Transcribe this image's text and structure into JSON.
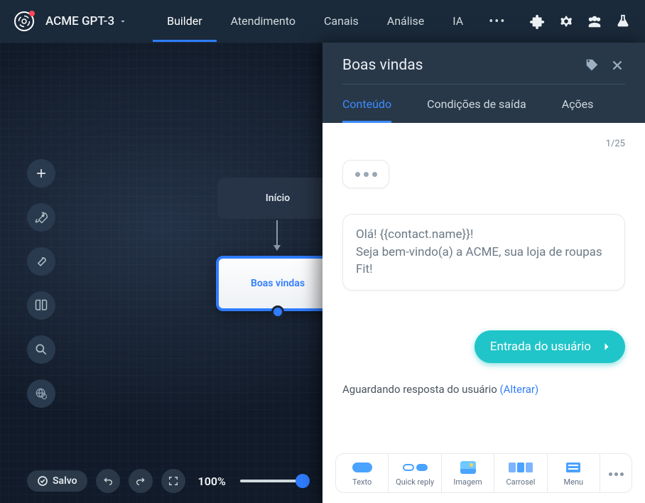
{
  "app_title": "ACME GPT-3",
  "nav": {
    "tabs": [
      "Builder",
      "Atendimento",
      "Canais",
      "Análise",
      "IA"
    ],
    "active": 0
  },
  "canvas": {
    "nodes": {
      "start": "Início",
      "welcome": "Boas vindas"
    },
    "save_label": "Salvo",
    "zoom_label": "100%"
  },
  "panel": {
    "title": "Boas vindas",
    "tabs": [
      "Conteúdo",
      "Condições de saída",
      "Ações"
    ],
    "active": 0,
    "counter": "1/25",
    "message": "Olá! {{contact.name}}!\nSeja bem-vindo(a) a ACME, sua loja de roupas Fit!",
    "user_input_label": "Entrada do usuário",
    "waiting_text": "Aguardando resposta do usuário ",
    "waiting_link": "(Alterar)",
    "content_types": [
      {
        "key": "texto",
        "label": "Texto"
      },
      {
        "key": "quickreply",
        "label": "Quick reply"
      },
      {
        "key": "imagem",
        "label": "Imagem"
      },
      {
        "key": "carrosel",
        "label": "Carrosel"
      },
      {
        "key": "menu",
        "label": "Menu"
      }
    ]
  }
}
